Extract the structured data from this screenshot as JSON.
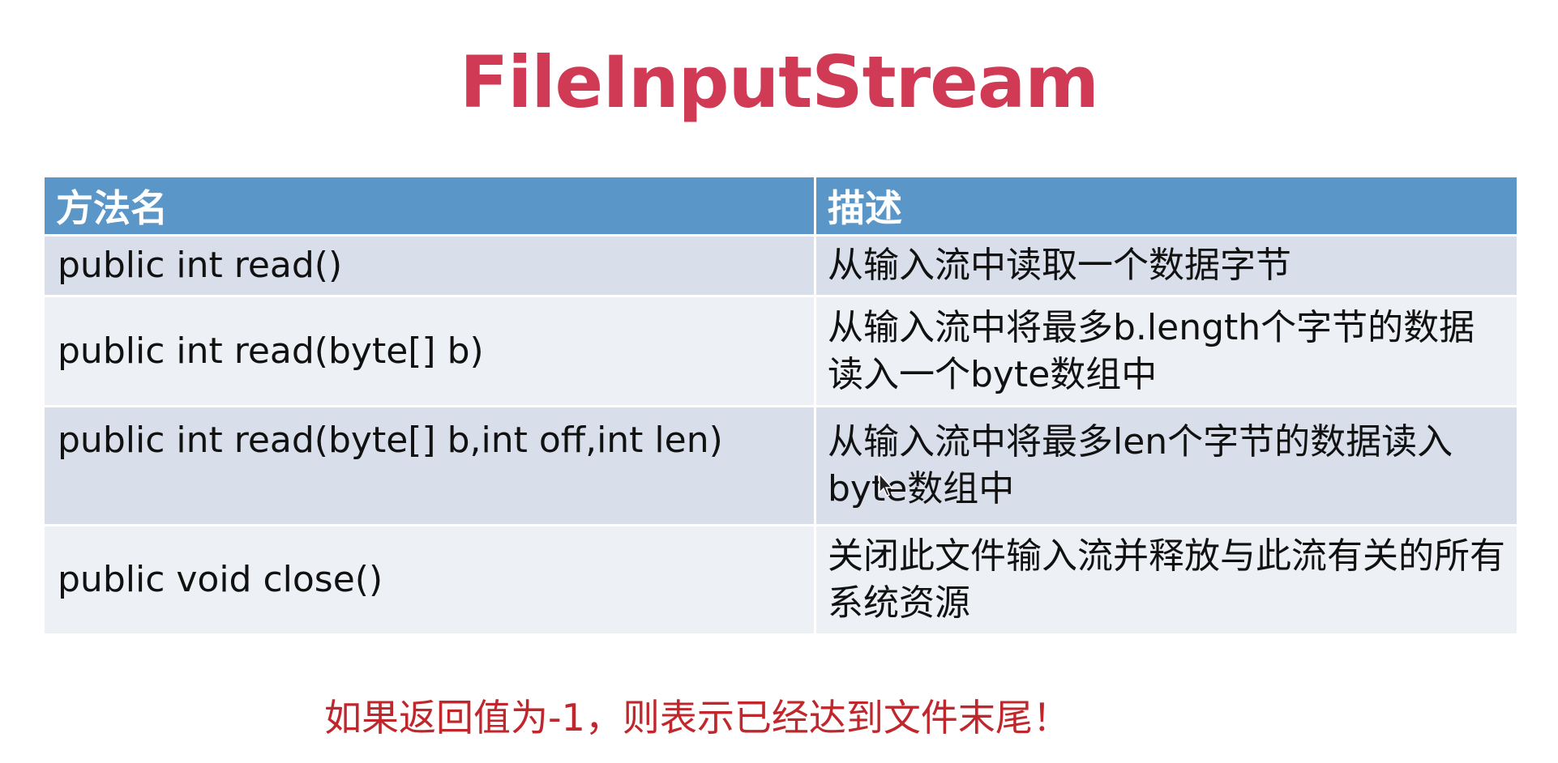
{
  "slide": {
    "title": "FileInputStream",
    "table": {
      "headers": [
        "方法名",
        "描述"
      ],
      "rows": [
        {
          "method": "public int read()",
          "description": "从输入流中读取一个数据字节"
        },
        {
          "method": "public int read(byte[] b)",
          "description": "从输入流中将最多b.length个字节的数据读入一个byte数组中"
        },
        {
          "method": "public int read(byte[] b,int off,int len)",
          "description": "从输入流中将最多len个字节的数据读入byte数组中"
        },
        {
          "method": "public void close()",
          "description": "关闭此文件输入流并释放与此流有关的所有系统资源"
        }
      ]
    },
    "note": "如果返回值为-1，则表示已经达到文件末尾！"
  },
  "colors": {
    "title": "#d13a55",
    "header_bg": "#5b96c8",
    "row_dark": "#d8dfeb",
    "row_light": "#edf0f5",
    "note": "#c0272d"
  },
  "icons": {
    "cursor": "mouse-pointer-icon"
  }
}
